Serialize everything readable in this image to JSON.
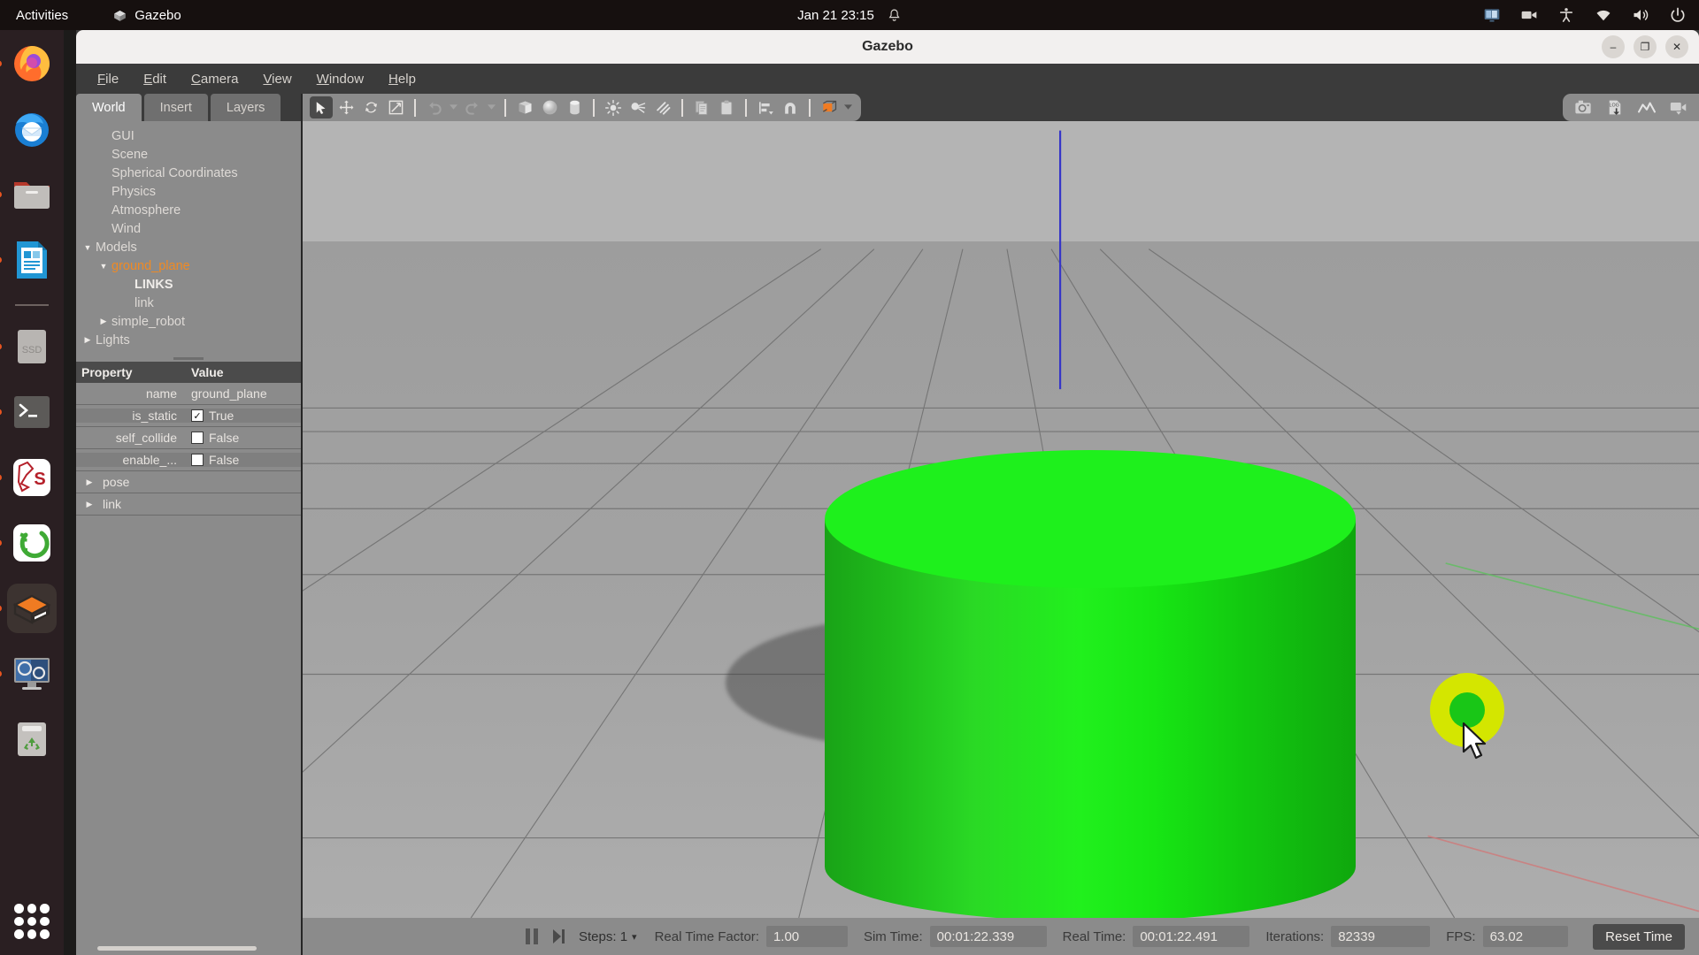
{
  "topbar": {
    "activities": "Activities",
    "app_name": "Gazebo",
    "app_icon": "gazebo-cube-icon",
    "clock": "Jan 21  23:15",
    "bell_icon": "notification-bell-icon",
    "tray": [
      {
        "name": "screencast-indicator-icon"
      },
      {
        "name": "camera-recording-icon"
      },
      {
        "name": "accessibility-icon"
      },
      {
        "name": "wifi-icon"
      },
      {
        "name": "volume-icon"
      },
      {
        "name": "power-icon"
      }
    ]
  },
  "dock": {
    "items": [
      {
        "name": "firefox",
        "running": true
      },
      {
        "name": "thunderbird",
        "running": false
      },
      {
        "name": "files",
        "running": true
      },
      {
        "name": "libreoffice-writer",
        "running": true
      },
      {
        "name": "ssd-drive",
        "running": true
      },
      {
        "name": "terminal",
        "running": true
      },
      {
        "name": "qgis",
        "running": true
      },
      {
        "name": "cloudcompare",
        "running": true
      },
      {
        "name": "gazebo",
        "running": true
      },
      {
        "name": "media-player",
        "running": true
      },
      {
        "name": "trash",
        "running": false
      }
    ],
    "show_apps": "show-applications-icon"
  },
  "window": {
    "title": "Gazebo",
    "minimize": "–",
    "maximize": "❐",
    "close": "✕"
  },
  "menubar": [
    {
      "label": "File",
      "mnemonic": "F"
    },
    {
      "label": "Edit",
      "mnemonic": "E"
    },
    {
      "label": "Camera",
      "mnemonic": "C"
    },
    {
      "label": "View",
      "mnemonic": "V"
    },
    {
      "label": "Window",
      "mnemonic": "W"
    },
    {
      "label": "Help",
      "mnemonic": "H"
    }
  ],
  "left_panel": {
    "tabs": [
      {
        "label": "World",
        "active": true
      },
      {
        "label": "Insert",
        "active": false
      },
      {
        "label": "Layers",
        "active": false
      }
    ],
    "tree": [
      {
        "label": "GUI",
        "indent": 1,
        "twisty": "",
        "style": "plain"
      },
      {
        "label": "Scene",
        "indent": 1,
        "twisty": "",
        "style": "plain"
      },
      {
        "label": "Spherical Coordinates",
        "indent": 1,
        "twisty": "",
        "style": "plain"
      },
      {
        "label": "Physics",
        "indent": 1,
        "twisty": "",
        "style": "plain"
      },
      {
        "label": "Atmosphere",
        "indent": 1,
        "twisty": "",
        "style": "plain"
      },
      {
        "label": "Wind",
        "indent": 1,
        "twisty": "",
        "style": "plain"
      },
      {
        "label": "Models",
        "indent": 0,
        "twisty": "▼",
        "style": "plain"
      },
      {
        "label": "ground_plane",
        "indent": 1,
        "twisty": "▼",
        "style": "sel"
      },
      {
        "label": "LINKS",
        "indent": 3,
        "twisty": "",
        "style": "bold"
      },
      {
        "label": "link",
        "indent": 3,
        "twisty": "",
        "style": "plain"
      },
      {
        "label": "simple_robot",
        "indent": 1,
        "twisty": "▶",
        "style": "plain"
      },
      {
        "label": "Lights",
        "indent": 0,
        "twisty": "▶",
        "style": "plain"
      }
    ],
    "property_table": {
      "headers": [
        "Property",
        "Value"
      ],
      "rows": [
        {
          "property": "name",
          "value": "ground_plane",
          "type": "text"
        },
        {
          "property": "is_static",
          "value": "True",
          "type": "checkbox",
          "checked": true
        },
        {
          "property": "self_collide",
          "value": "False",
          "type": "checkbox",
          "checked": false
        },
        {
          "property": "enable_...",
          "value": "False",
          "type": "checkbox",
          "checked": false
        }
      ],
      "groups": [
        {
          "label": "pose",
          "twisty": "▶"
        },
        {
          "label": "link",
          "twisty": "▶"
        }
      ]
    }
  },
  "toolbar": {
    "left": [
      {
        "name": "select-mode-button",
        "icon": "arrow-cursor-icon",
        "active": true
      },
      {
        "name": "translate-mode-button",
        "icon": "move-arrows-icon",
        "active": false
      },
      {
        "name": "rotate-mode-button",
        "icon": "rotate-arrows-icon",
        "active": false
      },
      {
        "name": "scale-mode-button",
        "icon": "scale-diagonal-icon",
        "active": false
      },
      {
        "name": "separator-1",
        "icon": "separator",
        "active": false
      },
      {
        "name": "undo-button",
        "icon": "undo-arrow-icon",
        "active": false
      },
      {
        "name": "undo-history-dropdown",
        "icon": "chevron-down-icon",
        "active": false
      },
      {
        "name": "redo-button",
        "icon": "redo-arrow-icon",
        "active": false
      },
      {
        "name": "redo-history-dropdown",
        "icon": "chevron-down-icon",
        "active": false
      },
      {
        "name": "separator-2",
        "icon": "separator",
        "active": false
      },
      {
        "name": "insert-box-button",
        "icon": "box-icon",
        "active": false
      },
      {
        "name": "insert-sphere-button",
        "icon": "sphere-icon",
        "active": false
      },
      {
        "name": "insert-cylinder-button",
        "icon": "cylinder-icon",
        "active": false
      },
      {
        "name": "separator-3",
        "icon": "separator",
        "active": false
      },
      {
        "name": "point-light-button",
        "icon": "point-light-icon",
        "active": false
      },
      {
        "name": "spot-light-button",
        "icon": "spot-light-icon",
        "active": false
      },
      {
        "name": "directional-light-button",
        "icon": "directional-light-icon",
        "active": false
      },
      {
        "name": "separator-4",
        "icon": "separator",
        "active": false
      },
      {
        "name": "copy-button",
        "icon": "copy-icon",
        "active": false
      },
      {
        "name": "paste-button",
        "icon": "paste-icon",
        "active": false
      },
      {
        "name": "separator-5",
        "icon": "separator",
        "active": false
      },
      {
        "name": "align-button",
        "icon": "align-icon",
        "active": false
      },
      {
        "name": "snap-button",
        "icon": "magnet-snap-icon",
        "active": false
      },
      {
        "name": "separator-6",
        "icon": "separator",
        "active": false
      },
      {
        "name": "view-mode-button",
        "icon": "orange-cube-icon",
        "active": false
      },
      {
        "name": "view-mode-dropdown",
        "icon": "chevron-down-icon",
        "active": false
      }
    ],
    "right": [
      {
        "name": "screenshot-button",
        "icon": "camera-icon"
      },
      {
        "name": "log-record-button",
        "icon": "log-download-icon",
        "label": "LOG"
      },
      {
        "name": "plot-button",
        "icon": "plot-line-icon"
      },
      {
        "name": "video-record-button",
        "icon": "video-camera-icon"
      }
    ]
  },
  "viewport": {
    "objects": [
      {
        "name": "ground-plane-grid",
        "type": "grid"
      },
      {
        "name": "green-cylinder",
        "type": "cylinder",
        "color": "#1ef01c"
      },
      {
        "name": "selection-ring-marker",
        "type": "ring",
        "color": "#d4e600"
      },
      {
        "name": "z-axis-line",
        "type": "axis",
        "color": "#3d3dcf"
      },
      {
        "name": "x-axis-line",
        "type": "axis",
        "color": "#cf5a5a"
      },
      {
        "name": "y-axis-line",
        "type": "axis",
        "color": "#5acf5a"
      }
    ],
    "cursor": "mouse-pointer-cursor"
  },
  "statusbar": {
    "pause_icon": "pause-icon",
    "step_icon": "step-forward-icon",
    "steps_label": "Steps: 1",
    "steps_caret": "▾",
    "real_time_factor_label": "Real Time Factor:",
    "real_time_factor_value": "1.00",
    "sim_time_label": "Sim Time:",
    "sim_time_value": "00:01:22.339",
    "real_time_label": "Real Time:",
    "real_time_value": "00:01:22.491",
    "iterations_label": "Iterations:",
    "iterations_value": "82339",
    "fps_label": "FPS:",
    "fps_value": "63.02",
    "reset_button": "Reset Time"
  },
  "colors": {
    "accent_orange": "#e95420",
    "cylinder_green": "#1ef01c",
    "marker_yellow": "#d4e600",
    "panel_gray": "#8b8b8b",
    "chrome_dark": "#3b3b3b",
    "selected_text": "#f08a23"
  }
}
